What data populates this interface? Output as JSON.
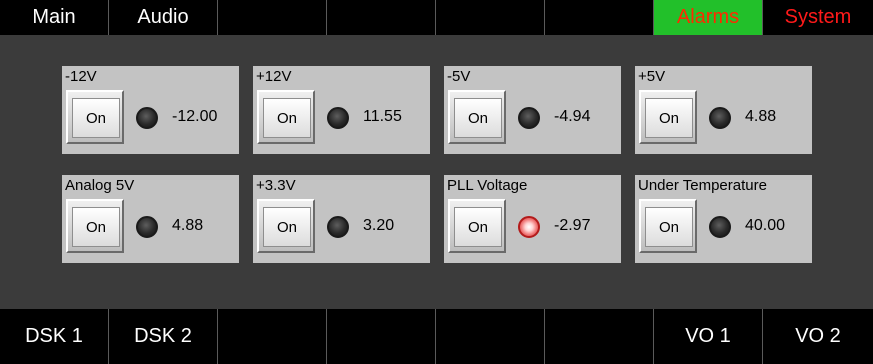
{
  "top_tabs": [
    {
      "label": "Main",
      "type": "normal"
    },
    {
      "label": "Audio",
      "type": "normal"
    },
    {
      "label": "",
      "type": "normal"
    },
    {
      "label": "",
      "type": "normal"
    },
    {
      "label": "",
      "type": "normal"
    },
    {
      "label": "",
      "type": "normal"
    },
    {
      "label": "Alarms",
      "type": "alarms"
    },
    {
      "label": "System",
      "type": "system"
    }
  ],
  "panels": [
    {
      "title": "-12V",
      "button": "On",
      "led": "off",
      "value": "-12.00"
    },
    {
      "title": "+12V",
      "button": "On",
      "led": "off",
      "value": "11.55"
    },
    {
      "title": "-5V",
      "button": "On",
      "led": "off",
      "value": "-4.94"
    },
    {
      "title": "+5V",
      "button": "On",
      "led": "off",
      "value": "4.88"
    },
    {
      "title": "Analog 5V",
      "button": "On",
      "led": "off",
      "value": "4.88"
    },
    {
      "title": "+3.3V",
      "button": "On",
      "led": "off",
      "value": "3.20"
    },
    {
      "title": "PLL Voltage",
      "button": "On",
      "led": "alarm",
      "value": "-2.97"
    },
    {
      "title": "Under Temperature",
      "button": "On",
      "led": "off",
      "value": "40.00"
    }
  ],
  "bottom_tabs": [
    {
      "label": "DSK 1"
    },
    {
      "label": "DSK 2"
    },
    {
      "label": ""
    },
    {
      "label": ""
    },
    {
      "label": ""
    },
    {
      "label": ""
    },
    {
      "label": "VO 1"
    },
    {
      "label": "VO 2"
    }
  ],
  "colors": {
    "alarms_tab_bg": "#22c02a",
    "alarm_text": "#ff1a1a",
    "led_alarm": "#f07a7a"
  }
}
